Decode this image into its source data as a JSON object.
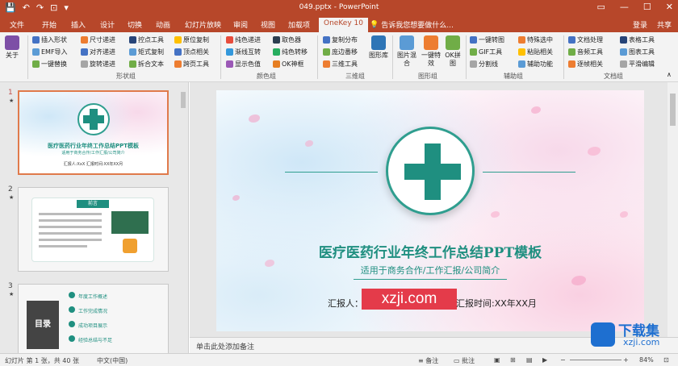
{
  "title_bar": {
    "qat": [
      "💾",
      "↶",
      "↷",
      "⊡",
      "▾"
    ],
    "doc_title": "049.pptx - PowerPoint",
    "window_controls": [
      "▭",
      "—",
      "☐",
      "✕"
    ]
  },
  "tabs": {
    "items": [
      "文件",
      "开始",
      "插入",
      "设计",
      "切换",
      "动画",
      "幻灯片放映",
      "审阅",
      "视图",
      "加载项",
      "OneKey 10"
    ],
    "active": "OneKey 10",
    "tell_me": "告诉我您想要做什么...",
    "right": [
      "登录",
      "共享"
    ]
  },
  "ribbon": {
    "about": "关于",
    "groups": [
      {
        "label": "形状组",
        "items": [
          "插入形状",
          "EMF导入",
          "一键替换",
          "尺寸递进",
          "对齐递进",
          "旋转递进",
          "控点工具",
          "矩式复制",
          "拆合文本",
          "原位复制",
          "顶点相关",
          "跨页工具"
        ]
      },
      {
        "label": "颜色组",
        "items": [
          "纯色递进",
          "渐线互转",
          "显示色值",
          "取色器",
          "纯色转移",
          "OK神框"
        ]
      },
      {
        "label": "三维组",
        "items": [
          "复制分布",
          "庞边番移",
          "三维工具",
          "图形库"
        ]
      },
      {
        "label": "图形组",
        "items": [
          "图片混合",
          "一键特效",
          "OK拼图"
        ]
      },
      {
        "label": "辅助组",
        "items": [
          "一键转图",
          "GIF工具",
          "分割线",
          "特殊选中",
          "粘贴相关",
          "辅助功能"
        ]
      },
      {
        "label": "文档组",
        "items": [
          "文档处理",
          "音频工具",
          "逐帧相关",
          "表格工具",
          "图表工具",
          "平滑编辑"
        ]
      }
    ]
  },
  "thumbnails": [
    {
      "num": "1",
      "star": "★",
      "title": "医疗医药行业年终工作总结PPT模板",
      "sub": "适用于商务合作/工作汇报/公司简介",
      "reporter": "汇报人:XxX  汇报时间:XX年XX月"
    },
    {
      "num": "2",
      "star": "★",
      "title": "前言"
    },
    {
      "num": "3",
      "star": "★",
      "title": "目录",
      "items": [
        "年度工作概述",
        "工作完成情况",
        "成功项目展示",
        "经验总结与不足"
      ]
    }
  ],
  "slide": {
    "title": "医疗医药行业年终工作总结PPT模板",
    "subtitle": "适用于商务合作/工作汇报/公司简介",
    "reporter": "汇报人：",
    "watermark": "xzji.com",
    "date": "汇报时间:XX年XX月"
  },
  "notes": "单击此处添加备注",
  "status": {
    "slide_info": "幻灯片 第 1 张，共 40 张",
    "lang": "中文(中国)",
    "notes_btn": "备注",
    "comments_btn": "批注",
    "zoom": "84%"
  },
  "sitemark": {
    "a": "下载集",
    "b": "xzji.com"
  },
  "colors": {
    "accent": "#b7472a",
    "slide_teal": "#1f8f80",
    "watermark_red": "#e43b4a"
  }
}
